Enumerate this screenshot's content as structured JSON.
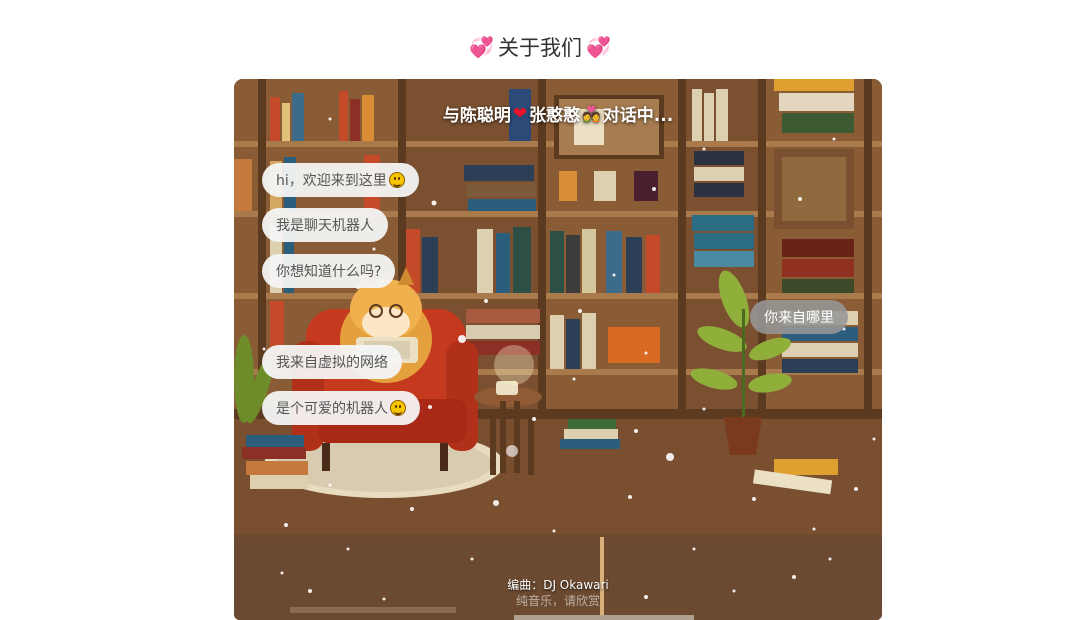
{
  "page": {
    "title": "关于我们"
  },
  "chat": {
    "header_prefix": "与陈聪明",
    "header_name": "张憨憨",
    "header_suffix": "对话中...",
    "bot_messages": [
      {
        "text": "hi，欢迎来到这里",
        "emoji": "grin-icon"
      },
      {
        "text": "我是聊天机器人",
        "emoji": ""
      },
      {
        "text": "你想知道什么吗?",
        "emoji": ""
      },
      {
        "text": "我来自虚拟的网络",
        "emoji": ""
      },
      {
        "text": "是个可爱的机器人",
        "emoji": "smile-icon"
      }
    ],
    "user_messages": [
      {
        "text": "你来自哪里"
      }
    ],
    "music_credit": "编曲：DJ Okawari",
    "music_note": "纯音乐，请欣赏"
  },
  "colors": {
    "heart": "#e0213b",
    "bot_bubble": "#f4f4f4",
    "user_bubble": "#969696",
    "title_text": "#333333"
  }
}
